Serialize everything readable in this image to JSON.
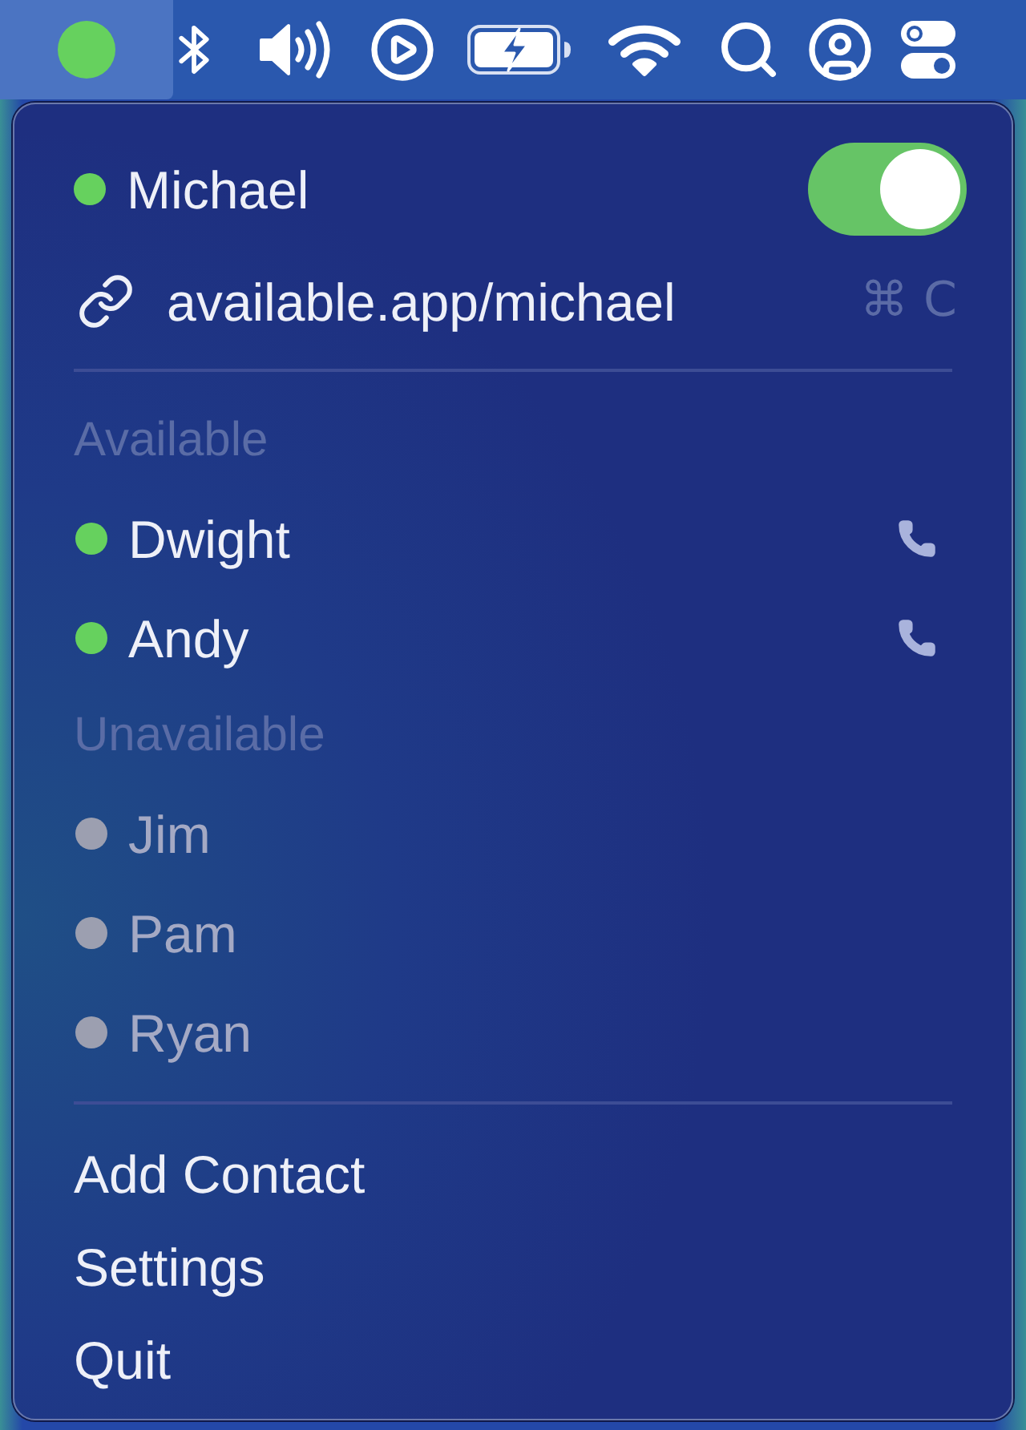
{
  "menu_bar": {
    "app_item": {
      "selected": true
    }
  },
  "status": {
    "name": "Michael",
    "available": true,
    "on": true
  },
  "share_link": {
    "url": "available.app/michael",
    "shortcut": "⌘ C"
  },
  "sections": [
    {
      "title": "Available",
      "contacts": [
        {
          "name": "Dwight",
          "available": true
        },
        {
          "name": "Andy",
          "available": true
        }
      ]
    },
    {
      "title": "Unavailable",
      "contacts": [
        {
          "name": "Jim",
          "available": false
        },
        {
          "name": "Pam",
          "available": false
        },
        {
          "name": "Ryan",
          "available": false
        }
      ]
    }
  ],
  "actions": [
    "Add Contact",
    "Settings",
    "Quit"
  ]
}
